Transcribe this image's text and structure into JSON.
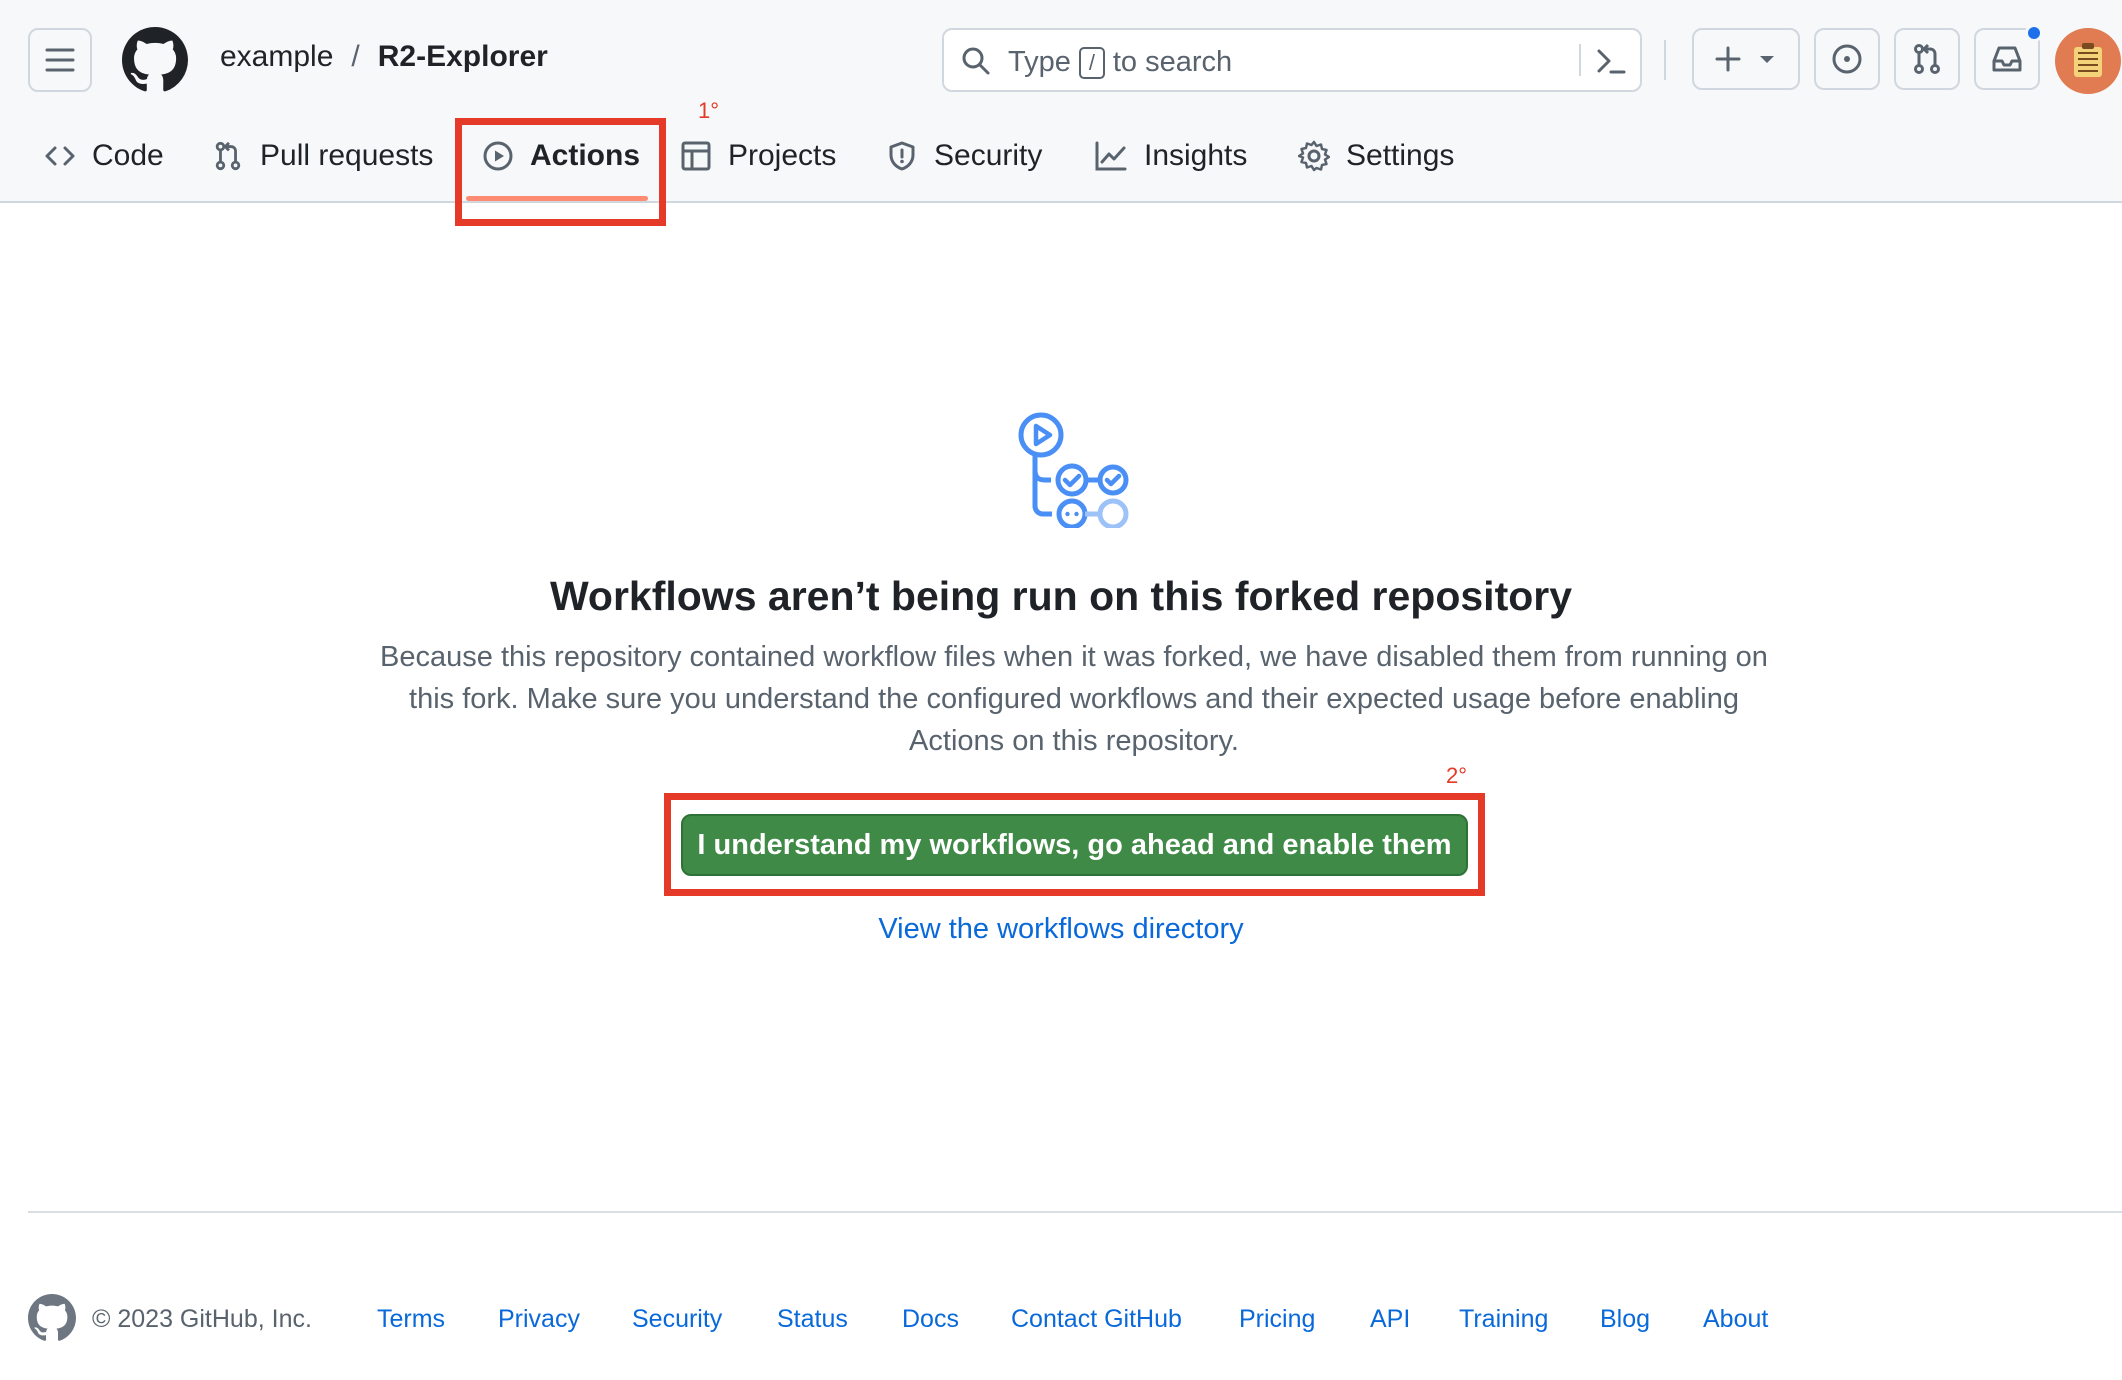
{
  "header": {
    "owner": "example",
    "separator": "/",
    "repo": "R2-Explorer",
    "search": {
      "prefix": "Type",
      "key": "/",
      "suffix": "to search"
    }
  },
  "tabs": [
    {
      "label": "Code",
      "icon": "code-icon"
    },
    {
      "label": "Pull requests",
      "icon": "pull-request-icon"
    },
    {
      "label": "Actions",
      "icon": "play-icon",
      "active": true
    },
    {
      "label": "Projects",
      "icon": "table-icon"
    },
    {
      "label": "Security",
      "icon": "shield-icon"
    },
    {
      "label": "Insights",
      "icon": "graph-icon"
    },
    {
      "label": "Settings",
      "icon": "gear-icon"
    }
  ],
  "annotations": {
    "first": "1°",
    "second": "2°"
  },
  "main": {
    "title": "Workflows aren’t being run on this forked repository",
    "description": "Because this repository contained workflow files when it was forked, we have disabled them from running on this fork. Make sure you understand the configured workflows and their expected usage before enabling Actions on this repository.",
    "enable_button": "I understand my workflows, go ahead and enable them",
    "view_link": "View the workflows directory"
  },
  "footer": {
    "copyright": "© 2023 GitHub, Inc.",
    "links": [
      "Terms",
      "Privacy",
      "Security",
      "Status",
      "Docs",
      "Contact GitHub",
      "Pricing",
      "API",
      "Training",
      "Blog",
      "About"
    ]
  },
  "colors": {
    "accent": "#0969da",
    "primary_button": "#3e8a46",
    "annotation": "#e53a27",
    "tab_underline": "#fd8c73"
  }
}
